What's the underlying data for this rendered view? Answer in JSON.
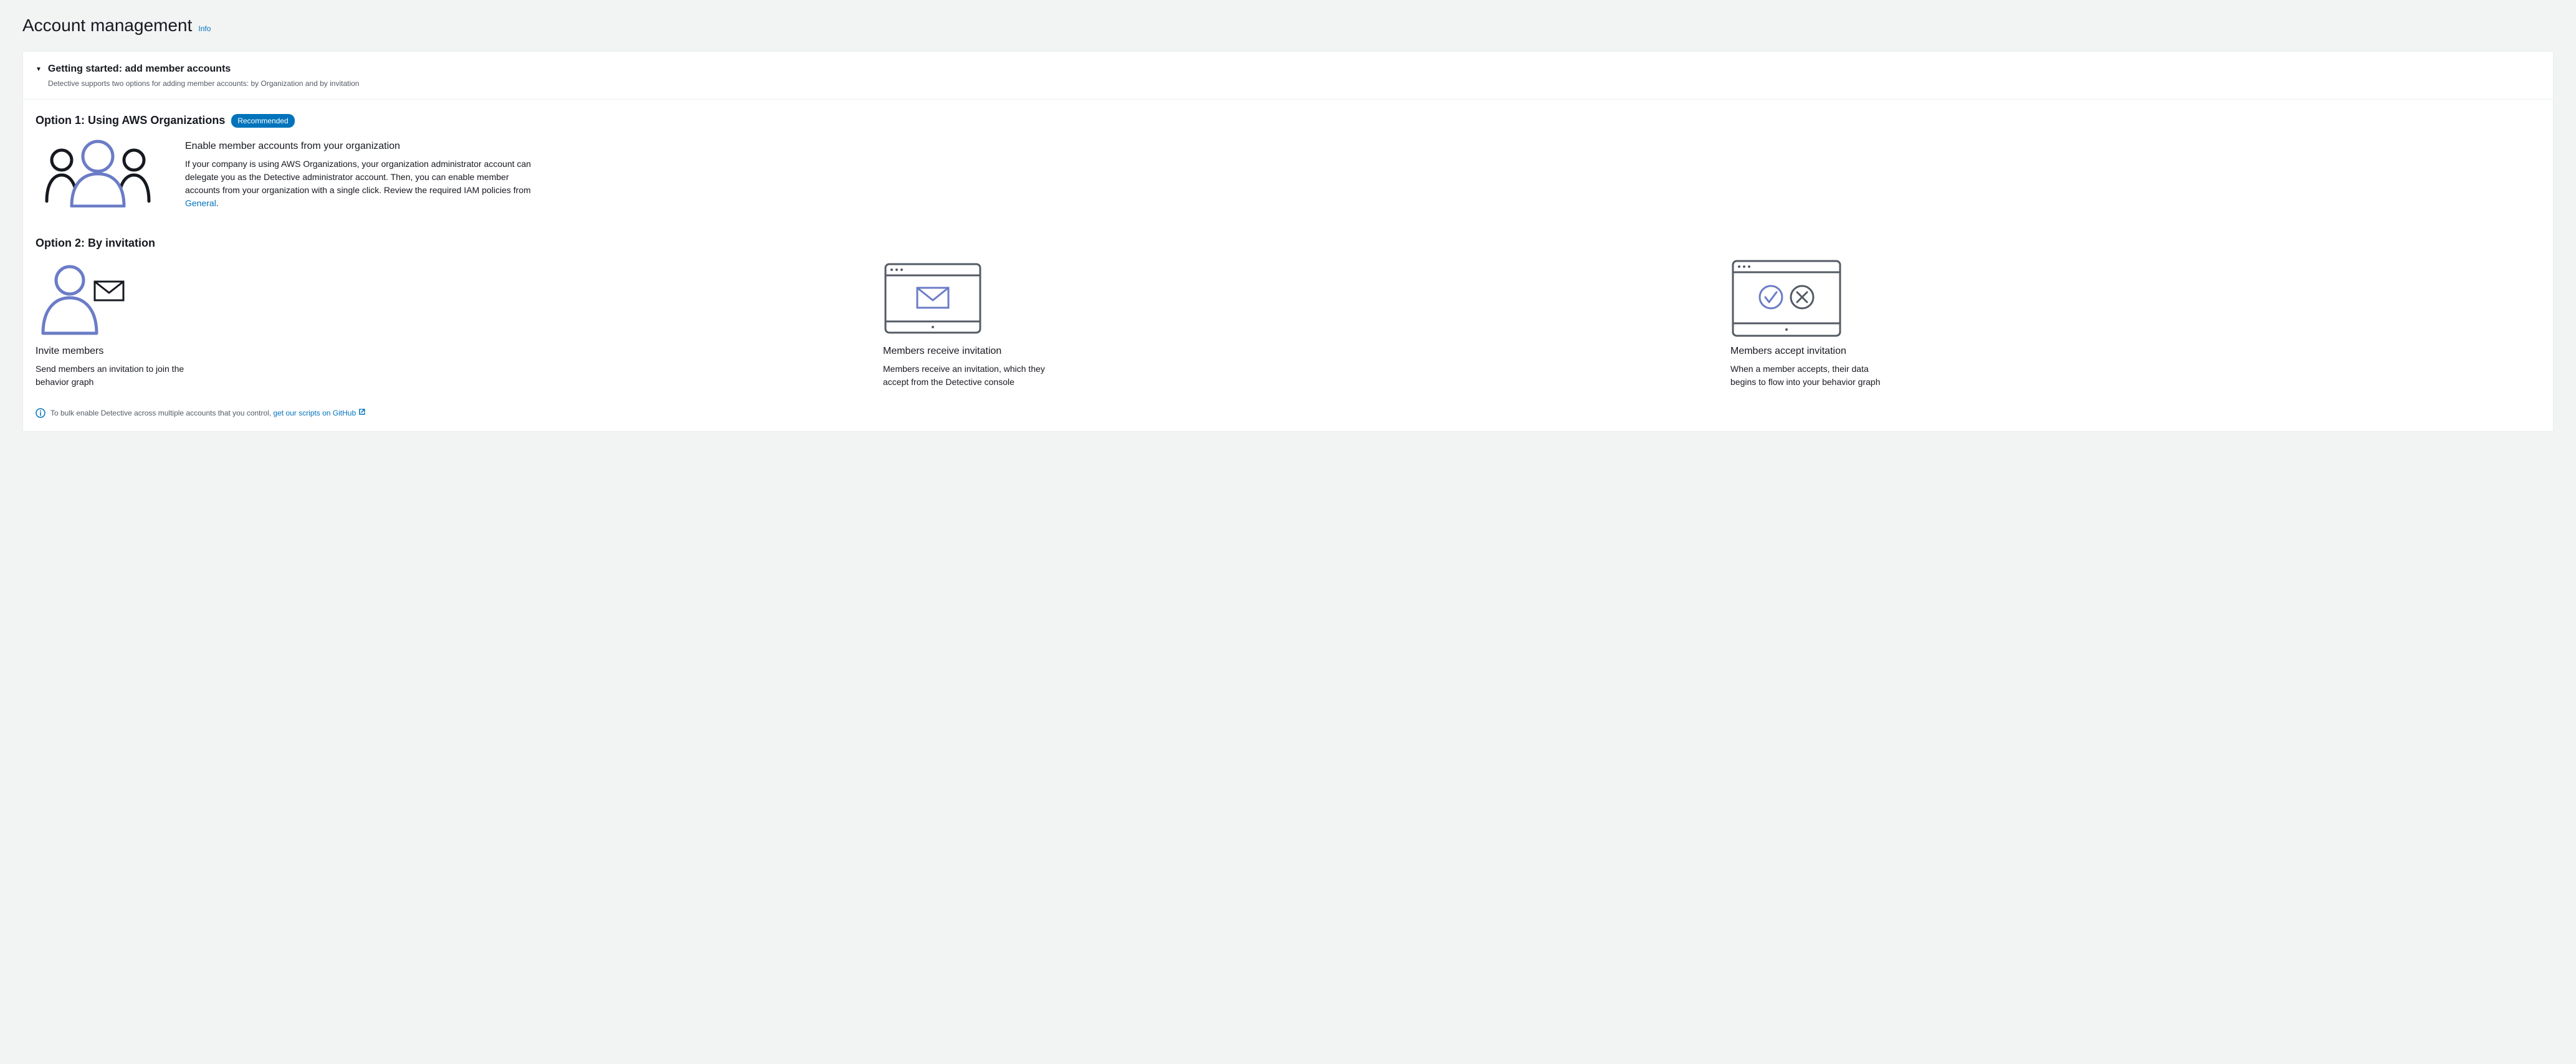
{
  "header": {
    "title": "Account management",
    "info_label": "Info"
  },
  "getting_started": {
    "title": "Getting started: add member accounts",
    "subtitle": "Detective supports two options for adding member accounts: by Organization and by invitation"
  },
  "option1": {
    "title": "Option 1: Using AWS Organizations",
    "badge": "Recommended",
    "heading": "Enable member accounts from your organization",
    "description_pre": "If your company is using AWS Organizations, your organization administrator account can delegate you as the Detective administrator account. Then, you can enable member accounts from your organization with a single click. Review the required IAM policies from ",
    "link_text": "General",
    "description_post": "."
  },
  "option2": {
    "title": "Option 2: By invitation",
    "steps": [
      {
        "heading": "Invite members",
        "description": "Send members an invitation to join the behavior graph"
      },
      {
        "heading": "Members receive invitation",
        "description": "Members receive an invitation, which they accept from the Detective console"
      },
      {
        "heading": "Members accept invitation",
        "description": "When a member accepts, their data begins to flow into your behavior graph"
      }
    ]
  },
  "footer": {
    "text_pre": "To bulk enable Detective across multiple accounts that you control, ",
    "link_text": "get our scripts on GitHub"
  }
}
